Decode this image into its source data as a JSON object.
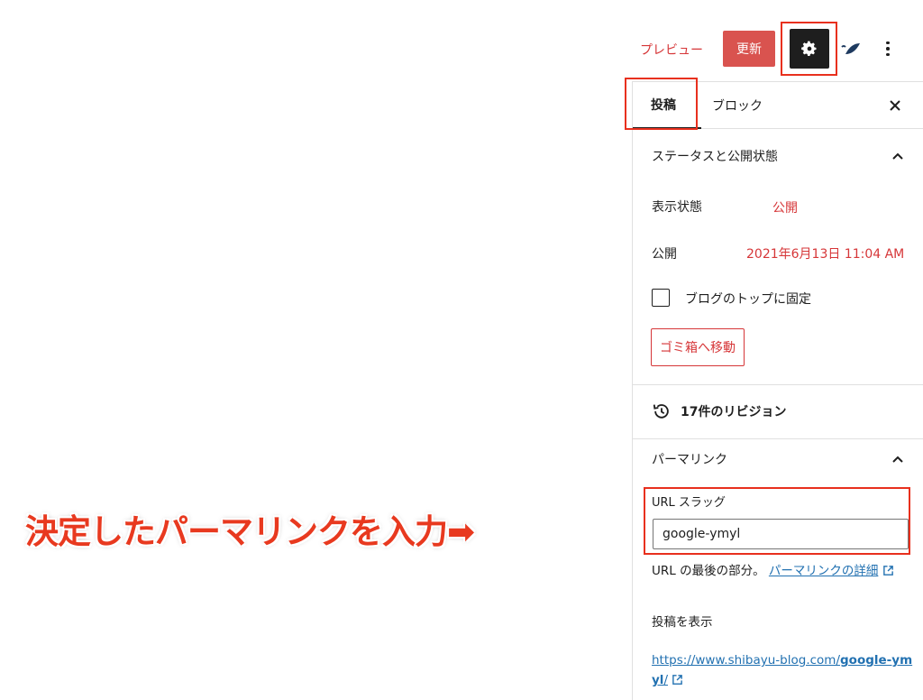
{
  "toolbar": {
    "preview_label": "プレビュー",
    "update_label": "更新",
    "settings_icon": "gear-icon",
    "plugin_icon": "plugin-leaf-icon",
    "more_icon": "more-vertical-icon"
  },
  "sidebar": {
    "tabs": [
      {
        "label": "投稿"
      },
      {
        "label": "ブロック"
      }
    ],
    "close_icon": "close-icon",
    "status_panel": {
      "title": "ステータスと公開状態",
      "visibility_label": "表示状態",
      "visibility_value": "公開",
      "publish_label": "公開",
      "publish_value": "2021年6月13日 11:04 AM",
      "sticky_label": "ブログのトップに固定",
      "trash_label": "ゴミ箱へ移動"
    },
    "revisions": {
      "label": "17件のリビジョン"
    },
    "permalink_panel": {
      "title": "パーマリンク",
      "slug_label": "URL スラッグ",
      "slug_value": "google-ymyl",
      "help_text": "URL の最後の部分。",
      "help_link": "パーマリンクの詳細",
      "view_post_label": "投稿を表示",
      "link_prefix": "https://www.shibayu-blog.com/",
      "link_slug": "google-ymyl",
      "link_suffix": "/"
    }
  },
  "annotation": {
    "text": "決定したパーマリンクを入力➡"
  },
  "colors": {
    "accent": "#d63638",
    "highlight": "#e8301e",
    "link": "#2271b1",
    "dark": "#1e1e1e"
  }
}
